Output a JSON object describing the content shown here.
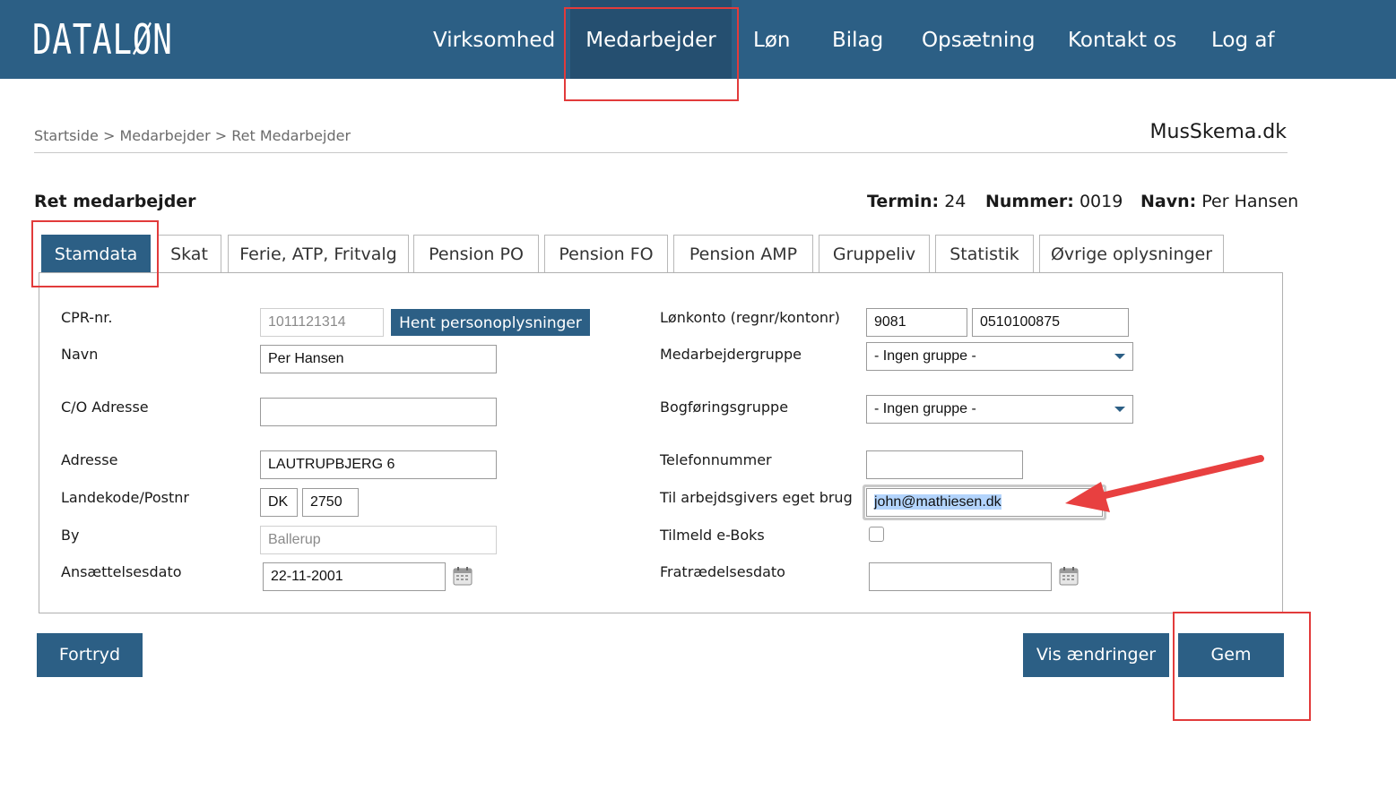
{
  "app": {
    "logo": "DATALØN",
    "brand": "MusSkema.dk"
  },
  "nav": {
    "items": [
      {
        "label": "Virksomhed"
      },
      {
        "label": "Medarbejder"
      },
      {
        "label": "Løn"
      },
      {
        "label": "Bilag"
      },
      {
        "label": "Opsætning"
      },
      {
        "label": "Kontakt os"
      },
      {
        "label": "Log af"
      }
    ],
    "active": "Medarbejder"
  },
  "breadcrumb": "Startside > Medarbejder > Ret Medarbejder",
  "page": {
    "title": "Ret medarbejder",
    "termin_label": "Termin:",
    "termin_value": "24",
    "nummer_label": "Nummer:",
    "nummer_value": "0019",
    "navn_label": "Navn:",
    "navn_value": "Per Hansen"
  },
  "tabs": [
    {
      "label": "Stamdata"
    },
    {
      "label": "Skat"
    },
    {
      "label": "Ferie, ATP, Fritvalg"
    },
    {
      "label": "Pension PO"
    },
    {
      "label": "Pension FO"
    },
    {
      "label": "Pension AMP"
    },
    {
      "label": "Gruppeliv"
    },
    {
      "label": "Statistik"
    },
    {
      "label": "Øvrige oplysninger"
    }
  ],
  "form": {
    "cpr": {
      "label": "CPR-nr.",
      "value": "1011121314",
      "button": "Hent personoplysninger"
    },
    "navn": {
      "label": "Navn",
      "value": "Per Hansen"
    },
    "co": {
      "label": "C/O Adresse",
      "value": ""
    },
    "adresse": {
      "label": "Adresse",
      "value": "LAUTRUPBJERG 6"
    },
    "landekode": {
      "label": "Landekode/Postnr",
      "country": "DK",
      "postnr": "2750"
    },
    "by": {
      "label": "By",
      "value": "Ballerup"
    },
    "ansaettelse": {
      "label": "Ansættelsesdato",
      "value": "22-11-2001"
    },
    "loenkonto": {
      "label": "Lønkonto (regnr/kontonr)",
      "regnr": "9081",
      "kontonr": "0510100875"
    },
    "medarbejdergruppe": {
      "label": "Medarbejdergruppe",
      "value": "- Ingen gruppe -"
    },
    "bogforingsgruppe": {
      "label": "Bogføringsgruppe",
      "value": "- Ingen gruppe -"
    },
    "telefon": {
      "label": "Telefonnummer",
      "value": ""
    },
    "arbejdsgiver": {
      "label": "Til arbejdsgivers eget brug",
      "value": "john@mathiesen.dk"
    },
    "eboks": {
      "label": "Tilmeld e-Boks",
      "checked": false
    },
    "fratraedelse": {
      "label": "Fratrædelsesdato",
      "value": ""
    }
  },
  "buttons": {
    "fortryd": "Fortryd",
    "vis_aendringer": "Vis ændringer",
    "gem": "Gem"
  },
  "colors": {
    "primary": "#2c5f85",
    "highlight": "#e23b3b",
    "selection": "#b3d4fc"
  }
}
